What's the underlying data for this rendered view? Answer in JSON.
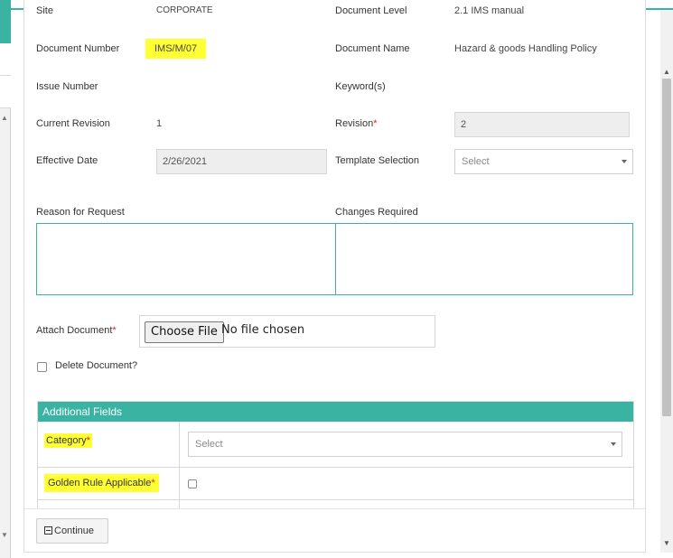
{
  "form": {
    "site_label": "Site",
    "site_value": "CORPORATE",
    "document_level_label": "Document Level",
    "document_level_value": "2.1 IMS manual",
    "document_number_label": "Document Number",
    "document_number_value": "IMS/M/07",
    "document_name_label": "Document Name",
    "document_name_value": "Hazard & goods Handling Policy",
    "issue_number_label": "Issue Number",
    "keywords_label": "Keyword(s)",
    "current_revision_label": "Current Revision",
    "current_revision_value": "1",
    "revision_label": "Revision",
    "revision_value": "2",
    "effective_date_label": "Effective Date",
    "effective_date_value": "2/26/2021",
    "template_selection_label": "Template Selection",
    "template_selection_value": "Select",
    "reason_label": "Reason for Request",
    "changes_label": "Changes Required",
    "attach_label": "Attach Document",
    "choose_file_label": "Choose File",
    "no_file_text": "No file chosen",
    "delete_label": "Delete Document?",
    "required_mark": "*"
  },
  "additional_fields": {
    "title": "Additional Fields",
    "category_label": "Category",
    "category_value": "Select",
    "golden_rule_label": "Golden Rule Applicable"
  },
  "footer": {
    "continue_label": "Continue"
  },
  "icons": {
    "save": "floppy-disk-icon",
    "caret": "caret-down-icon"
  },
  "colors": {
    "accent": "#3bb3a3",
    "highlight": "#ffff33",
    "required": "#e02020"
  }
}
